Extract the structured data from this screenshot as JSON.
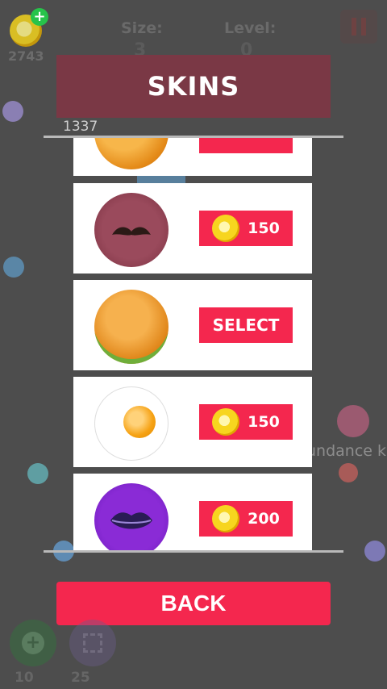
{
  "hud": {
    "coins": "2743",
    "size_label": "Size:",
    "size_value": "3",
    "level_label": "Level:",
    "level_value": "0"
  },
  "dialog": {
    "title": "SKINS",
    "score": "1337",
    "back_label": "BACK"
  },
  "skins": [
    {
      "name": "cookie",
      "action": ""
    },
    {
      "name": "mustache",
      "action": "price",
      "price": "150"
    },
    {
      "name": "burger",
      "action": "select",
      "label": "SELECT"
    },
    {
      "name": "fried-egg",
      "action": "price",
      "price": "150"
    },
    {
      "name": "lips",
      "action": "price",
      "price": "200"
    }
  ],
  "bottom": {
    "left_count": "10",
    "right_count": "25"
  },
  "peer_name": "undance k",
  "colors": {
    "accent": "#f4274e",
    "title_bg": "#7a3845",
    "background": "#4d4d4d"
  }
}
